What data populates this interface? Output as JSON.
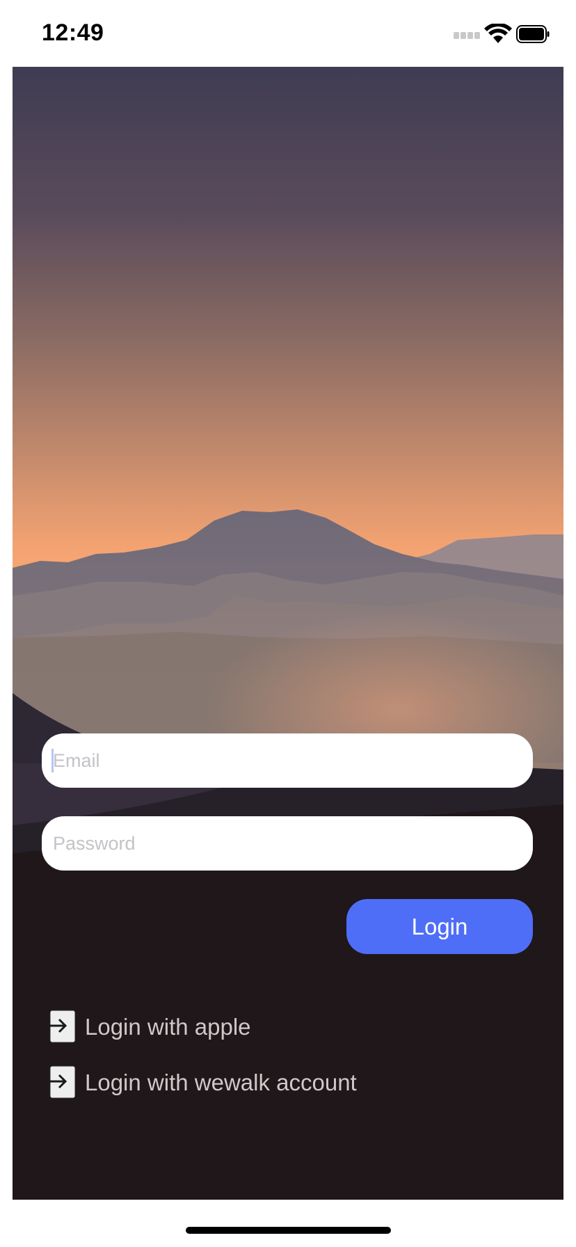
{
  "status_bar": {
    "time": "12:49"
  },
  "form": {
    "email_placeholder": "Email",
    "password_placeholder": "Password",
    "login_label": "Login"
  },
  "alt_logins": [
    {
      "label": "Login with apple",
      "icon": "login-arrow-icon"
    },
    {
      "label": "Login with wewalk account",
      "icon": "login-arrow-icon"
    }
  ],
  "colors": {
    "accent": "#4f6ef7",
    "sky_top": "#3f3c52",
    "sky_mid": "#ffac74",
    "ground": "#1f171a"
  }
}
